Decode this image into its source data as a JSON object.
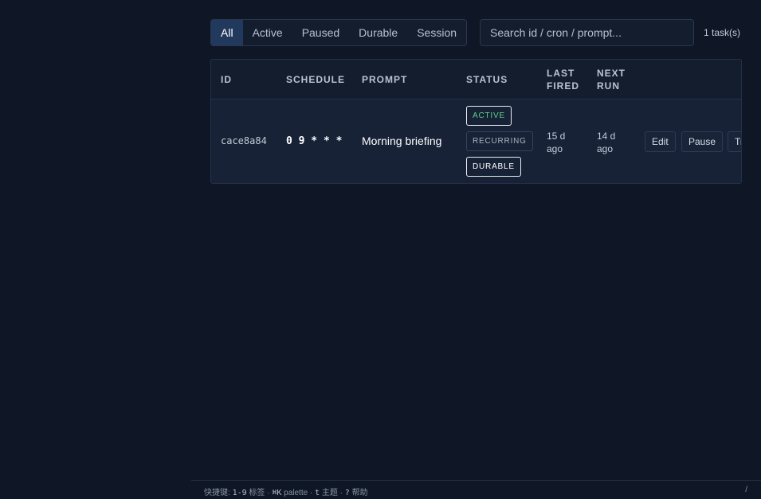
{
  "filters": {
    "tabs": [
      "All",
      "Active",
      "Paused",
      "Durable",
      "Session"
    ],
    "selected": "All"
  },
  "search": {
    "placeholder": "Search id / cron / prompt..."
  },
  "task_count": "1 task(s)",
  "table": {
    "headers": {
      "id": "ID",
      "schedule": "SCHEDULE",
      "prompt": "PROMPT",
      "status": "STATUS",
      "last_fired_1": "LAST",
      "last_fired_2": "FIRED",
      "next_run_1": "NEXT",
      "next_run_2": "RUN"
    },
    "rows": [
      {
        "id": "cace8a84",
        "schedule": "0 9 * * *",
        "prompt": "Morning briefing",
        "badges": {
          "active": "ACTIVE",
          "recurring": "RECURRING",
          "durable": "DURABLE"
        },
        "last_fired": "15 d ago",
        "next_run": "14 d ago",
        "actions": {
          "edit": "Edit",
          "pause": "Pause",
          "trigger": "Tr"
        }
      }
    ]
  },
  "footer": {
    "label": "快捷键:",
    "k1": "1-9",
    "t1": "标签",
    "k2": "⌘K",
    "t2": "palette",
    "k3": "t",
    "t3": "主题",
    "k4": "?",
    "t4": "帮助",
    "sep": "·",
    "right": "/"
  },
  "colors": {
    "background": "#0f1625",
    "panel": "#141d2e",
    "accent_tab": "#22395e",
    "active_badge_text": "#5fd08a"
  }
}
